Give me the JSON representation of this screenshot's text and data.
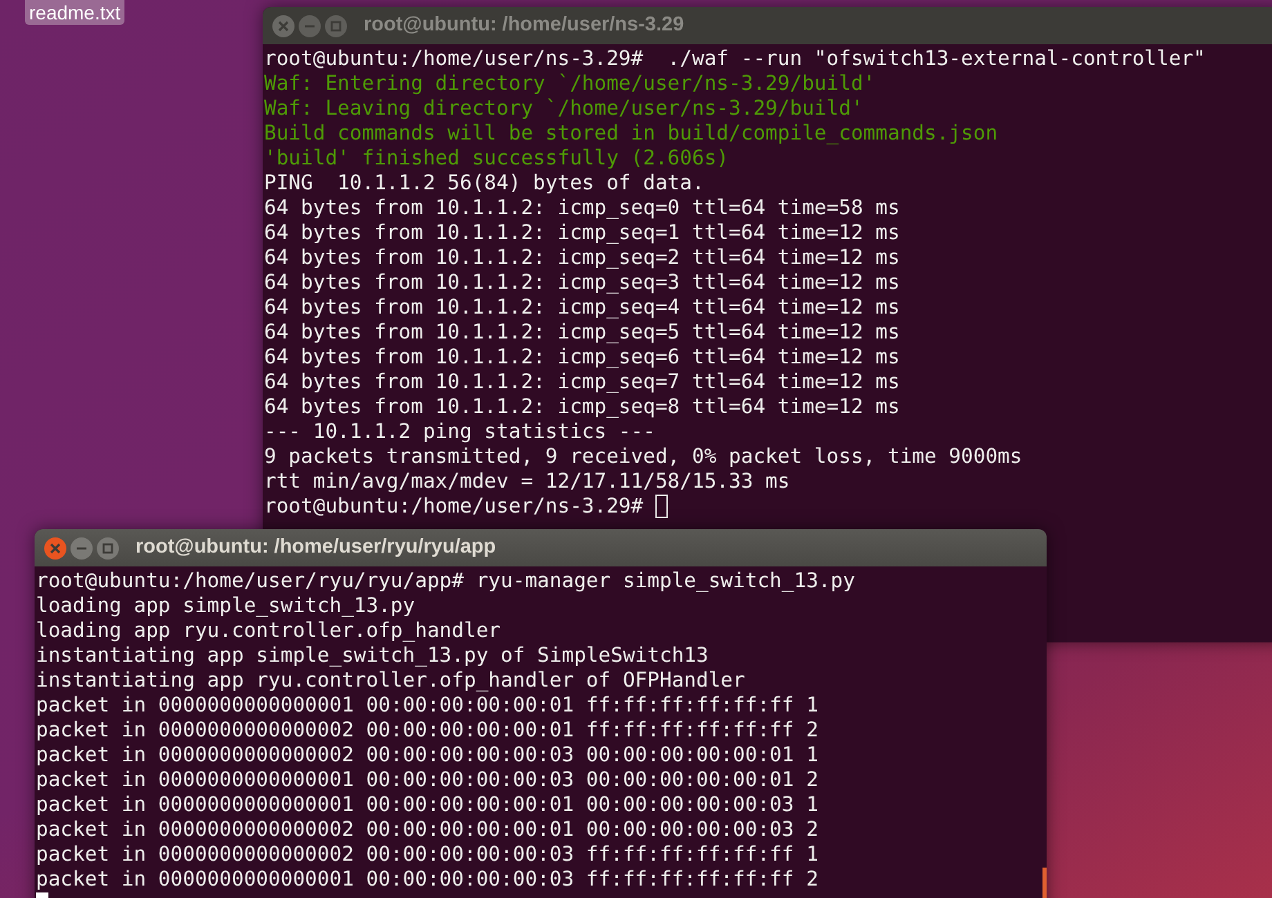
{
  "desktop_icon": {
    "label": "readme.txt"
  },
  "windows": [
    {
      "title": "root@ubuntu: /home/user/ns-3.29",
      "active": false,
      "lines": [
        {
          "kind": "output",
          "text": "root@ubuntu:/home/user/ns-3.29#  ./waf --run \"ofswitch13-external-controller\""
        },
        {
          "kind": "info",
          "text": "Waf: Entering directory `/home/user/ns-3.29/build'"
        },
        {
          "kind": "info",
          "text": "Waf: Leaving directory `/home/user/ns-3.29/build'"
        },
        {
          "kind": "info",
          "text": "Build commands will be stored in build/compile_commands.json"
        },
        {
          "kind": "info",
          "text": "'build' finished successfully (2.606s)"
        },
        {
          "kind": "output",
          "text": "PING  10.1.1.2 56(84) bytes of data."
        },
        {
          "kind": "output",
          "text": "64 bytes from 10.1.1.2: icmp_seq=0 ttl=64 time=58 ms"
        },
        {
          "kind": "output",
          "text": "64 bytes from 10.1.1.2: icmp_seq=1 ttl=64 time=12 ms"
        },
        {
          "kind": "output",
          "text": "64 bytes from 10.1.1.2: icmp_seq=2 ttl=64 time=12 ms"
        },
        {
          "kind": "output",
          "text": "64 bytes from 10.1.1.2: icmp_seq=3 ttl=64 time=12 ms"
        },
        {
          "kind": "output",
          "text": "64 bytes from 10.1.1.2: icmp_seq=4 ttl=64 time=12 ms"
        },
        {
          "kind": "output",
          "text": "64 bytes from 10.1.1.2: icmp_seq=5 ttl=64 time=12 ms"
        },
        {
          "kind": "output",
          "text": "64 bytes from 10.1.1.2: icmp_seq=6 ttl=64 time=12 ms"
        },
        {
          "kind": "output",
          "text": "64 bytes from 10.1.1.2: icmp_seq=7 ttl=64 time=12 ms"
        },
        {
          "kind": "output",
          "text": "64 bytes from 10.1.1.2: icmp_seq=8 ttl=64 time=12 ms"
        },
        {
          "kind": "output",
          "text": "--- 10.1.1.2 ping statistics ---"
        },
        {
          "kind": "output",
          "text": "9 packets transmitted, 9 received, 0% packet loss, time 9000ms"
        },
        {
          "kind": "output",
          "text": "rtt min/avg/max/mdev = 12/17.11/58/15.33 ms"
        },
        {
          "kind": "output",
          "text": "root@ubuntu:/home/user/ns-3.29# "
        }
      ]
    },
    {
      "title": "root@ubuntu: /home/user/ryu/ryu/app",
      "active": true,
      "lines": [
        {
          "kind": "output",
          "text": "root@ubuntu:/home/user/ryu/ryu/app# ryu-manager simple_switch_13.py"
        },
        {
          "kind": "output",
          "text": "loading app simple_switch_13.py"
        },
        {
          "kind": "output",
          "text": "loading app ryu.controller.ofp_handler"
        },
        {
          "kind": "output",
          "text": "instantiating app simple_switch_13.py of SimpleSwitch13"
        },
        {
          "kind": "output",
          "text": "instantiating app ryu.controller.ofp_handler of OFPHandler"
        },
        {
          "kind": "output",
          "text": "packet in 0000000000000001 00:00:00:00:00:01 ff:ff:ff:ff:ff:ff 1"
        },
        {
          "kind": "output",
          "text": "packet in 0000000000000002 00:00:00:00:00:01 ff:ff:ff:ff:ff:ff 2"
        },
        {
          "kind": "output",
          "text": "packet in 0000000000000002 00:00:00:00:00:03 00:00:00:00:00:01 1"
        },
        {
          "kind": "output",
          "text": "packet in 0000000000000001 00:00:00:00:00:03 00:00:00:00:00:01 2"
        },
        {
          "kind": "output",
          "text": "packet in 0000000000000001 00:00:00:00:00:01 00:00:00:00:00:03 1"
        },
        {
          "kind": "output",
          "text": "packet in 0000000000000002 00:00:00:00:00:01 00:00:00:00:00:03 2"
        },
        {
          "kind": "output",
          "text": "packet in 0000000000000002 00:00:00:00:00:03 ff:ff:ff:ff:ff:ff 1"
        },
        {
          "kind": "output",
          "text": "packet in 0000000000000001 00:00:00:00:00:03 ff:ff:ff:ff:ff:ff 2"
        }
      ]
    }
  ]
}
